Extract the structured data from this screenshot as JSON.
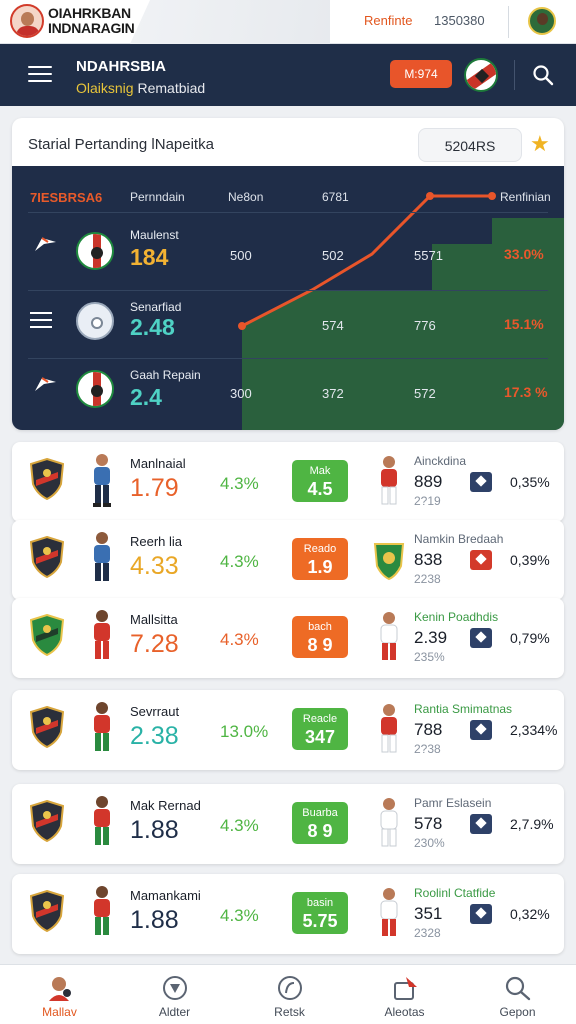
{
  "top": {
    "brand_line1": "OIAHRKBAN",
    "brand_line2": "INDNARAGIN",
    "link": "Renfinte",
    "number": "1350380"
  },
  "nav": {
    "title": "NDAHRSBIA",
    "subtitle_highlight": "Olaiksnig",
    "subtitle_rest": " Rematbiad",
    "badge": "M:974"
  },
  "standings": {
    "title": "Starial Pertanding lNapeitka",
    "pill": "5204RS",
    "header_accent": "7IESBRSA6",
    "headers": [
      "Pernndain",
      "Ne8on",
      "6781",
      "Renfinian"
    ],
    "rows": [
      {
        "name": "Maulenst",
        "odd": "184",
        "odd_color": "#f2b233",
        "c1": "500",
        "c2": "502",
        "c3": "5571",
        "pct": "33.0%"
      },
      {
        "name": "Senarfiad",
        "odd": "2.48",
        "odd_color": "#4fd2c5",
        "c1": "",
        "c2": "574",
        "c3": "776",
        "pct": "15.1%"
      },
      {
        "name": "Gaah Repain",
        "odd": "2.4",
        "odd_color": "#4fd2c5",
        "c1": "300",
        "c2": "372",
        "c3": "572",
        "pct": "17.3 %"
      }
    ]
  },
  "matches": [
    {
      "name": "Manlnaial",
      "odd": "1.79",
      "odd_color": "#e8612a",
      "pct": "4.3%",
      "pct_color": "#4fb543",
      "btn_label": "Mak",
      "btn_value": "4.5",
      "btn_color": "green",
      "opp": "Ainckdina",
      "val": "889",
      "sub": "2?19",
      "icon_color": "navy",
      "right": "0,35%"
    },
    {
      "name": "Reerh lia",
      "odd": "4.33",
      "odd_color": "#e9a726",
      "pct": "4.3%",
      "pct_color": "#4fb543",
      "btn_label": "Reado",
      "btn_value": "1.9",
      "btn_color": "orange",
      "opp": "Namkin Bredaah",
      "val": "838",
      "sub": "2238",
      "icon_color": "red",
      "right": "0,39%"
    },
    {
      "name": "Mallsitta",
      "odd": "7.28",
      "odd_color": "#e8612a",
      "pct": "4.3%",
      "pct_color": "#e8612a",
      "btn_label": "bach",
      "btn_value": "8 9",
      "btn_color": "orange",
      "opp": "Kenin Poadhdis",
      "val": "2.39",
      "sub": "235%",
      "icon_color": "navy",
      "right": "0,79%"
    },
    {
      "name": "Sevrraut",
      "odd": "2.38",
      "odd_color": "#29b2a6",
      "pct": "13.0%",
      "pct_color": "#4fb543",
      "btn_label": "Reacle",
      "btn_value": "347",
      "btn_color": "green",
      "opp": "Rantia Smimatnas",
      "val": "788",
      "sub": "2?38",
      "icon_color": "navy",
      "right": "2,334%"
    },
    {
      "name": "Mak Rernad",
      "odd": "1.88",
      "odd_color": "#1f2e48",
      "pct": "4.3%",
      "pct_color": "#4fb543",
      "btn_label": "Buarba",
      "btn_value": "8 9",
      "btn_color": "green",
      "opp": "Pamr Eslasein",
      "val": "578",
      "sub": "230%",
      "icon_color": "navy",
      "right": "2,7.9%"
    },
    {
      "name": "Mamankami",
      "odd": "1.88",
      "odd_color": "#1f2e48",
      "pct": "4.3%",
      "pct_color": "#4fb543",
      "btn_label": "basin",
      "btn_value": "5.75",
      "btn_color": "green",
      "opp": "Roolinl Ctatfide",
      "val": "351",
      "sub": "2328",
      "icon_color": "navy",
      "right": "0,32%"
    }
  ],
  "tabs": [
    {
      "label": "Mallav",
      "icon": "players-icon",
      "active": true
    },
    {
      "label": "Aldter",
      "icon": "ball-icon",
      "active": false
    },
    {
      "label": "Retsk",
      "icon": "stats-icon",
      "active": false
    },
    {
      "label": "Aleotas",
      "icon": "alerts-icon",
      "active": false
    },
    {
      "label": "Gepon",
      "icon": "search-icon",
      "active": false
    }
  ]
}
